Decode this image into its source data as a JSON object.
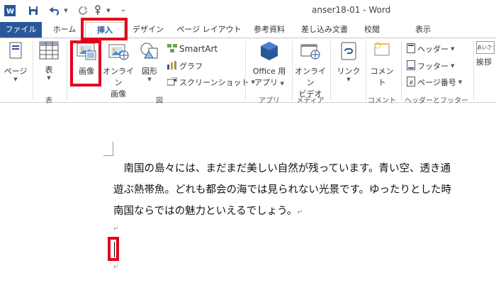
{
  "titlebar": {
    "word_icon": "word-app-icon",
    "doc_title": "anser18-01 - Word"
  },
  "tabs": [
    {
      "label": "ファイル"
    },
    {
      "label": "ホーム"
    },
    {
      "label": "挿入"
    },
    {
      "label": "デザイン"
    },
    {
      "label": "ページ レイアウト"
    },
    {
      "label": "参考資料"
    },
    {
      "label": "差し込み文書"
    },
    {
      "label": "校閲"
    },
    {
      "label": "表示"
    }
  ],
  "ribbon": {
    "page_label": "ページ",
    "table_label": "表",
    "table_group": "表",
    "image_label": "画像",
    "online_image_line1": "オンライン",
    "online_image_line2": "画像",
    "shapes_label": "図形",
    "smartart_label": "SmartArt",
    "graph_label": "グラフ",
    "screenshot_label": "スクリーンショット",
    "figure_group": "図",
    "office_app_line1": "Office 用",
    "office_app_line2": "アプリ",
    "app_group": "アプリ",
    "online_video_line1": "オンライン",
    "online_video_line2": "ビデオ",
    "media_group": "メディア",
    "link_label": "リンク",
    "comment_label": "コメント",
    "comment_group": "コメント",
    "header_label": "ヘッダー",
    "footer_label": "フッター",
    "page_number_label": "ページ番号",
    "header_footer_group": "ヘッダーとフッター",
    "greeting_label": "挨拶",
    "greeting_thumb": "あいさつ"
  },
  "document": {
    "line1": "　南国の島々には、まだまだ美しい自然が残っています。青い空、透き通",
    "line2": "遊ぶ熱帯魚。どれも都会の海では見られない光景です。ゆったりとした時",
    "line3": "南国ならではの魅力といえるでしょう。",
    "para_mark": "↵"
  },
  "colors": {
    "accent": "#2b579a",
    "highlight": "#e4001b"
  }
}
